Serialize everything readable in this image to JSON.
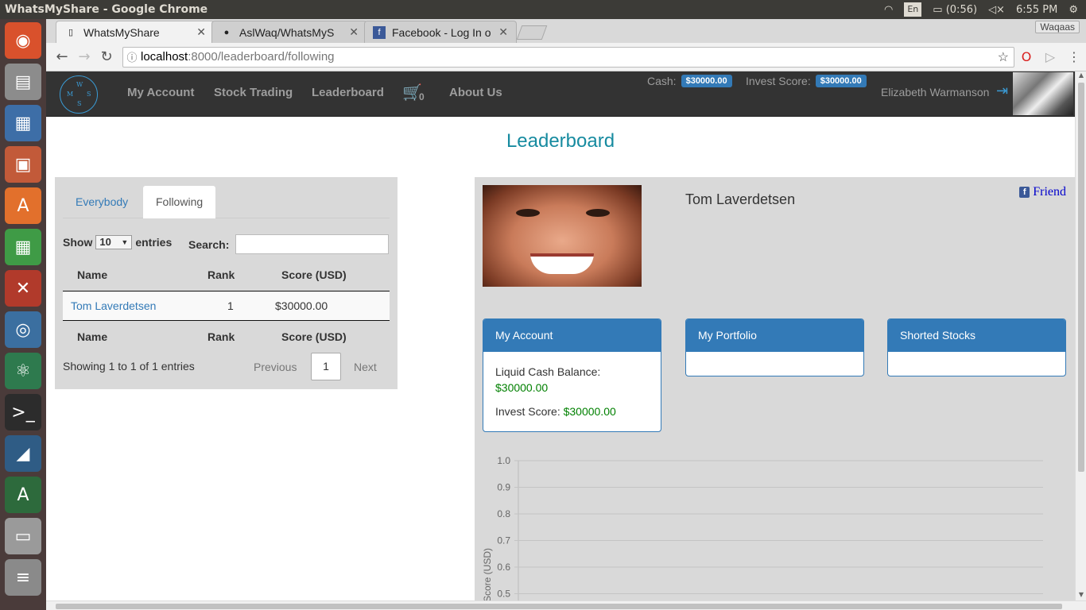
{
  "os": {
    "window_title": "WhatsMyShare - Google Chrome",
    "keyboard": "En",
    "battery": "(0:56)",
    "time": "6:55 PM"
  },
  "browser": {
    "tabs": [
      {
        "title": "WhatsMyShare",
        "icon": "page-icon"
      },
      {
        "title": "AslWaq/WhatsMyS",
        "icon": "github-icon"
      },
      {
        "title": "Facebook - Log In o",
        "icon": "facebook-icon"
      }
    ],
    "profile": "Waqaas",
    "url_host": "localhost",
    "url_path": ":8000/leaderboard/following"
  },
  "site": {
    "logo_letters": {
      "w": "W",
      "m": "M",
      "s_right": "S",
      "s_bottom": "S"
    },
    "nav": {
      "my_account": "My Account",
      "stock_trading": "Stock Trading",
      "leaderboard": "Leaderboard",
      "cart_count": "0",
      "about_us": "About Us"
    },
    "cash_label": "Cash:",
    "cash_value": "$30000.00",
    "invest_label": "Invest Score:",
    "invest_value": "$30000.00",
    "username": "Elizabeth Warmanson"
  },
  "page": {
    "title": "Leaderboard"
  },
  "leaderboard": {
    "tabs": {
      "everybody": "Everybody",
      "following": "Following"
    },
    "show": "Show",
    "entries_value": "10",
    "entries": "entries",
    "search_label": "Search:",
    "columns": {
      "name": "Name",
      "rank": "Rank",
      "score": "Score (USD)"
    },
    "rows": [
      {
        "name": "Tom Laverdetsen",
        "rank": "1",
        "score": "$30000.00"
      }
    ],
    "info": "Showing 1 to 1 of 1 entries",
    "previous": "Previous",
    "current_page": "1",
    "next": "Next"
  },
  "profile": {
    "name": "Tom Laverdetsen",
    "friend": "Friend",
    "cards": {
      "account": {
        "title": "My Account",
        "liquid_label": "Liquid Cash Balance:",
        "liquid_value": "$30000.00",
        "invest_label": "Invest Score:",
        "invest_value": "$30000.00"
      },
      "portfolio": {
        "title": "My Portfolio"
      },
      "shorted": {
        "title": "Shorted Stocks"
      }
    }
  },
  "chart_data": {
    "type": "line",
    "ylabel": "Score (USD)",
    "yticks": [
      "1.0",
      "0.9",
      "0.8",
      "0.7",
      "0.6",
      "0.5"
    ],
    "ylim": [
      0.5,
      1.0
    ],
    "grid": true,
    "series": []
  }
}
